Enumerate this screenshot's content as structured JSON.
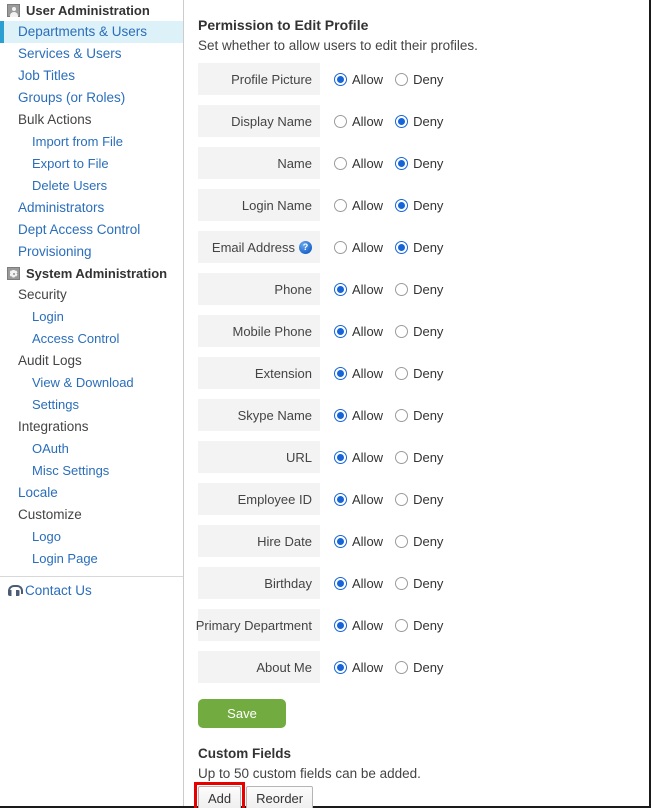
{
  "sidebar": {
    "sections": [
      {
        "icon": "user-icon",
        "title": "User Administration",
        "items": [
          {
            "label": "Departments & Users",
            "level": "top",
            "selected": true
          },
          {
            "label": "Services & Users",
            "level": "top",
            "selected": false
          },
          {
            "label": "Job Titles",
            "level": "top",
            "selected": false
          },
          {
            "label": "Groups (or Roles)",
            "level": "top",
            "selected": false
          },
          {
            "label": "Bulk Actions",
            "level": "parent",
            "selected": false
          },
          {
            "label": "Import from File",
            "level": "child",
            "selected": false
          },
          {
            "label": "Export to File",
            "level": "child",
            "selected": false
          },
          {
            "label": "Delete Users",
            "level": "child",
            "selected": false
          },
          {
            "label": "Administrators",
            "level": "top",
            "selected": false
          },
          {
            "label": "Dept Access Control",
            "level": "top",
            "selected": false
          },
          {
            "label": "Provisioning",
            "level": "top",
            "selected": false
          }
        ]
      },
      {
        "icon": "gear-icon",
        "title": "System Administration",
        "items": [
          {
            "label": "Security",
            "level": "parent",
            "selected": false
          },
          {
            "label": "Login",
            "level": "child",
            "selected": false
          },
          {
            "label": "Access Control",
            "level": "child",
            "selected": false
          },
          {
            "label": "Audit Logs",
            "level": "parent",
            "selected": false
          },
          {
            "label": "View & Download",
            "level": "child",
            "selected": false
          },
          {
            "label": "Settings",
            "level": "child",
            "selected": false
          },
          {
            "label": "Integrations",
            "level": "parent",
            "selected": false
          },
          {
            "label": "OAuth",
            "level": "child",
            "selected": false
          },
          {
            "label": "Misc Settings",
            "level": "child",
            "selected": false
          },
          {
            "label": "Locale",
            "level": "top",
            "selected": false
          },
          {
            "label": "Customize",
            "level": "parent",
            "selected": false
          },
          {
            "label": "Logo",
            "level": "child",
            "selected": false
          },
          {
            "label": "Login Page",
            "level": "child",
            "selected": false
          }
        ]
      }
    ],
    "contact": {
      "label": "Contact Us",
      "icon": "headset-icon"
    }
  },
  "main": {
    "title": "Permission to Edit Profile",
    "subtitle": "Set whether to allow users to edit their profiles.",
    "allow_label": "Allow",
    "deny_label": "Deny",
    "help_glyph": "?",
    "rows": [
      {
        "label": "Profile Picture",
        "value": "Allow",
        "help": false
      },
      {
        "label": "Display Name",
        "value": "Deny",
        "help": false
      },
      {
        "label": "Name",
        "value": "Deny",
        "help": false
      },
      {
        "label": "Login Name",
        "value": "Deny",
        "help": false
      },
      {
        "label": "Email Address",
        "value": "Deny",
        "help": true
      },
      {
        "label": "Phone",
        "value": "Allow",
        "help": false
      },
      {
        "label": "Mobile Phone",
        "value": "Allow",
        "help": false
      },
      {
        "label": "Extension",
        "value": "Allow",
        "help": false
      },
      {
        "label": "Skype Name",
        "value": "Allow",
        "help": false
      },
      {
        "label": "URL",
        "value": "Allow",
        "help": false
      },
      {
        "label": "Employee ID",
        "value": "Allow",
        "help": false
      },
      {
        "label": "Hire Date",
        "value": "Allow",
        "help": false
      },
      {
        "label": "Birthday",
        "value": "Allow",
        "help": false
      },
      {
        "label": "Primary Department",
        "value": "Allow",
        "help": false
      },
      {
        "label": "About Me",
        "value": "Allow",
        "help": false
      }
    ],
    "save_label": "Save",
    "custom_fields": {
      "title": "Custom Fields",
      "subtitle": "Up to 50 custom fields can be added.",
      "add_label": "Add",
      "reorder_label": "Reorder"
    }
  },
  "colors": {
    "accent_link": "#2a6ebb",
    "selected_bg": "#ddf1f8",
    "selected_bar": "#2b9fd0",
    "save_green": "#72ab3f",
    "radio_blue": "#1565d8",
    "highlight_red": "#e60000"
  }
}
